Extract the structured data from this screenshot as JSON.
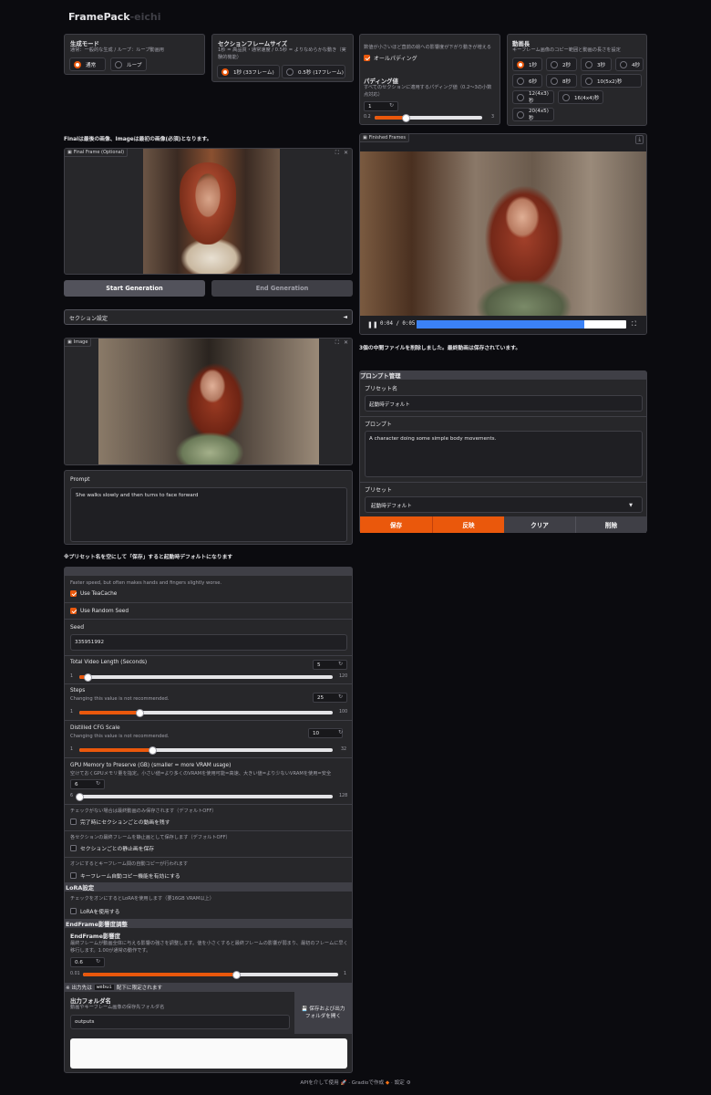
{
  "app": {
    "title_main": "FramePack",
    "title_suffix": "-eichi"
  },
  "gen_mode": {
    "title": "生成モード",
    "desc": "通常：一般的な生成 / ループ：ループ動画用",
    "options": [
      "通常",
      "ループ"
    ],
    "selected": 0
  },
  "section_size": {
    "title": "セクションフレームサイズ",
    "desc": "1秒 = 高品質・通常速度 / 0.5秒 = よりなめらかな動き（実験的機能）",
    "options": [
      "1秒 (33フレーム)",
      "0.5秒 (17フレーム)"
    ],
    "selected": 0
  },
  "padding": {
    "desc": "数値が小さいほど直前の絵への影響度が下がり動きが増える",
    "all_padding_label": "オールパディング",
    "all_padding_checked": true,
    "value_title": "パディング値",
    "value_desc": "すべてのセクションに適用するパディング値（0.2〜3の小数点対応）",
    "value": "1",
    "min": "0.2",
    "max": "3",
    "fraction": 0.29
  },
  "video_len": {
    "title": "動画長",
    "desc": "キーフレーム画像のコピー範囲と動画の長さを設定",
    "options": [
      "1秒",
      "2秒",
      "3秒",
      "4秒",
      "6秒",
      "8秒",
      "10(5x2)秒",
      "12(4x3)秒",
      "16(4x4)秒",
      "20(4x5)秒"
    ],
    "selected": 0
  },
  "notice_final": "Finalは最後の画像、Imageは最初の画像(必須)となります。",
  "final_frame": {
    "label": "Final Frame (Optional)"
  },
  "buttons": {
    "start": "Start Generation",
    "end": "End Generation"
  },
  "section_settings": {
    "label": "セクション設定",
    "arrow": "◄"
  },
  "image": {
    "label": "Image"
  },
  "prompt": {
    "label": "Prompt",
    "value": "She walks slowly and then turns to face forward"
  },
  "notice_preset": "※プリセット名を空にして「保存」すると起動時デフォルトになります",
  "finished": {
    "label": "Finished Frames",
    "time": "0:04 / 0:05",
    "progress": 0.8,
    "download_icon": "download-icon"
  },
  "delete_msg": "3個の中間ファイルを削除しました。最終動画は保存されています。",
  "preset": {
    "header": "プロンプト管理",
    "name_label": "プリセット名",
    "name_value": "起動時デフォルト",
    "prompt_label": "プロンプト",
    "prompt_value": "A character doing some simple body movements.",
    "select_label": "プリセット",
    "select_value": "起動時デフォルト",
    "buttons": [
      "保存",
      "反映",
      "クリア",
      "削除"
    ]
  },
  "settings": {
    "teacache_desc": "Faster speed, but often makes hands and fingers slightly worse.",
    "teacache_label": "Use TeaCache",
    "teacache": true,
    "random_seed_label": "Use Random Seed",
    "random_seed": true,
    "seed_label": "Seed",
    "seed_value": "335951992",
    "total_len": {
      "label": "Total Video Length (Seconds)",
      "value": "5",
      "min": "1",
      "max": "120",
      "fraction": 0.034
    },
    "steps": {
      "label": "Steps",
      "desc": "Changing this value is not recommended.",
      "value": "25",
      "min": "1",
      "max": "100",
      "fraction": 0.24
    },
    "cfg": {
      "label": "Distilled CFG Scale",
      "desc": "Changing this value is not recommended.",
      "value": "10",
      "min": "1",
      "max": "32",
      "fraction": 0.29
    },
    "gpu": {
      "label": "GPU Memory to Preserve (GB) (smaller = more VRAM usage)",
      "desc": "空けておくGPUメモリ量を指定。小さい値=より多くのVRAMを使用可能=高速、大きい値=より少ないVRAMを使用=安全",
      "value": "6",
      "min": "6",
      "max": "128",
      "fraction": 0.0
    },
    "keep_section_desc": "チェックがない場合は最終動画のみ保存されます（デフォルトOFF）",
    "keep_section_label": "完了時にセクションごとの動画を残す",
    "save_still_desc": "各セクションの最終フレームを静止画として保存します（デフォルトOFF）",
    "save_still_label": "セクションごとの静止画を保存",
    "keyframe_desc": "オンにするとキーフレーム間の自動コピーが行われます",
    "keyframe_label": "キーフレーム自動コピー機能を有効にする",
    "lora_header": "LoRA設定",
    "lora_desc": "チェックをオンにするとLoRAを使用します（要16GB VRAM以上）",
    "lora_label": "LoRAを使用する",
    "endframe_header": "EndFrame影響度調整",
    "endframe_title": "EndFrame影響度",
    "endframe_desc": "最終フレームが動画全体に与える影響の強さを調整します。値を小さくすると最終フレームの影響が弱まり、最初のフレームに早く移行します。1.00が通常の動作です。",
    "endframe": {
      "value": "0.6",
      "min": "0.01",
      "max": "1",
      "fraction": 0.6
    },
    "output_notice_pre": "※ 出力先は",
    "output_notice_code": "webui",
    "output_notice_post": "配下に限定されます",
    "output_folder_label": "出力フォルダ名",
    "output_folder_desc": "動画やキーフレーム画像の保存先フォルダ名",
    "output_folder_value": "outputs",
    "open_folder": "💾 保存および出力フォルダを開く"
  },
  "footer": {
    "api": "APIを介して使用",
    "gradio": "Gradioで作成",
    "settings": "設定"
  },
  "colors": {
    "accent": "#ea580c",
    "bg": "#0b0b0f",
    "panel": "#27272a"
  }
}
